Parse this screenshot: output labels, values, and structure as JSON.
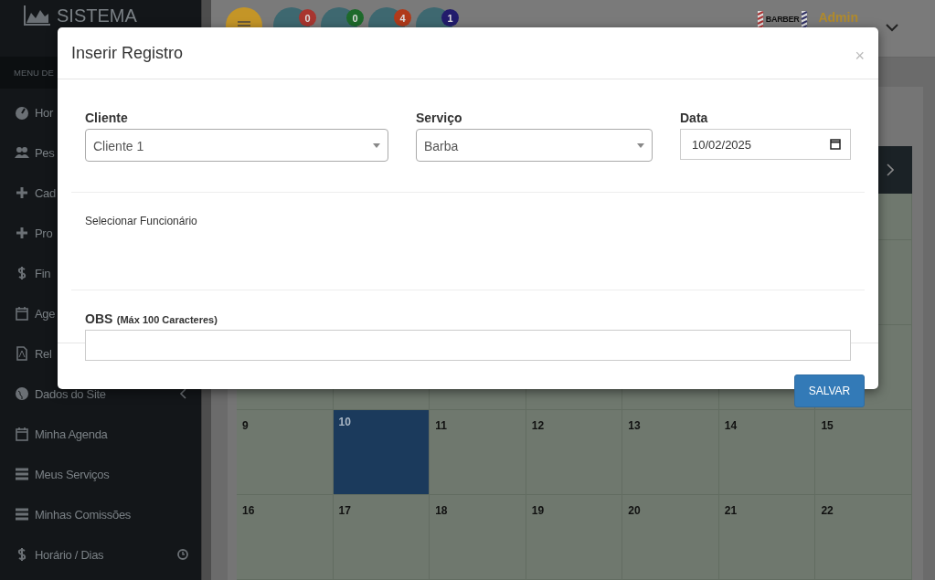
{
  "sidebar": {
    "brand": "SISTEMA",
    "menu_heading": "MENU DE",
    "items": [
      {
        "label": "Hor"
      },
      {
        "label": "Pes"
      },
      {
        "label": "Cad"
      },
      {
        "label": "Pro"
      },
      {
        "label": "Fin"
      },
      {
        "label": "Age"
      },
      {
        "label": "Rel"
      },
      {
        "label": "Dados do Site",
        "kind": "submenu"
      },
      {
        "label": "Minha Agenda"
      },
      {
        "label": "Meus Serviços"
      },
      {
        "label": "Minhas Comissões"
      },
      {
        "label": "Horário / Dias",
        "kind": "clock"
      }
    ]
  },
  "header": {
    "notifications": [
      {
        "kind": "menu"
      },
      {
        "kind": "badge",
        "count": "0",
        "color": "#a8352f"
      },
      {
        "kind": "badge",
        "count": "0",
        "color": "#1d6a2b"
      },
      {
        "kind": "badge",
        "count": "4",
        "color": "#b03a1a"
      },
      {
        "kind": "badge",
        "count": "1",
        "color": "#221c6c"
      }
    ],
    "logo_text": "BARBER",
    "user": "Admin"
  },
  "calendar": {
    "weeks": [
      [
        {
          "day": "9",
          "selected": false
        },
        {
          "day": "10",
          "selected": true
        },
        {
          "day": "11",
          "selected": false
        },
        {
          "day": "12",
          "selected": false
        },
        {
          "day": "13",
          "selected": false
        },
        {
          "day": "14",
          "selected": false
        },
        {
          "day": "15",
          "selected": false
        }
      ],
      [
        {
          "day": "16",
          "selected": false
        },
        {
          "day": "17",
          "selected": false
        },
        {
          "day": "18",
          "selected": false
        },
        {
          "day": "19",
          "selected": false
        },
        {
          "day": "20",
          "selected": false
        },
        {
          "day": "21",
          "selected": false
        },
        {
          "day": "22",
          "selected": false
        }
      ]
    ]
  },
  "modal": {
    "title": "Inserir Registro",
    "close": "×",
    "fields": [
      {
        "label": "Cliente",
        "kind": "select",
        "value": "Cliente 1"
      },
      {
        "label": "Serviço",
        "kind": "select",
        "value": "Barba"
      },
      {
        "label": "Data",
        "kind": "date",
        "value": "10/02/2025"
      }
    ],
    "employee_label": "Selecionar Funcionário",
    "obs_label": "OBS",
    "obs_note": "(Máx 100 Caracteres)",
    "save_button": "SALVAR"
  }
}
